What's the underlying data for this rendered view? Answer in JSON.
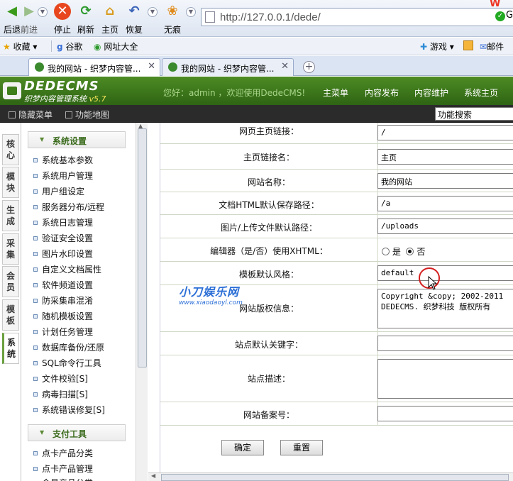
{
  "browser": {
    "nav": {
      "back": "后退",
      "forward": "前进",
      "stop": "停止",
      "refresh": "刷新",
      "home": "主页",
      "restore": "恢复",
      "incognito": "无痕"
    },
    "address": "http://127.0.0.1/dede/",
    "address_right_logo": "W",
    "go_label": "G"
  },
  "favorites": {
    "collect": "收藏",
    "google": "谷歌",
    "sites": "网址大全",
    "games": "游戏",
    "mail": "邮件"
  },
  "tabs": [
    {
      "label": "我的网站 - 织梦内容管..."
    },
    {
      "label": "我的网站 - 织梦内容管..."
    }
  ],
  "cms": {
    "logo_main": "DEDECMS",
    "logo_sub": "织梦内容管理系统",
    "version": "v5.7",
    "welcome": "您好：admin ，欢迎使用DedeCMS!",
    "topnav": [
      "主菜单",
      "内容发布",
      "内容维护",
      "系统主页"
    ],
    "hide_menu": "隐藏菜单",
    "func_map": "功能地图",
    "func_search": "功能搜索"
  },
  "vtabs": [
    {
      "label": "核心"
    },
    {
      "label": "模块"
    },
    {
      "label": "生成"
    },
    {
      "label": "采集"
    },
    {
      "label": "会员"
    },
    {
      "label": "模板"
    },
    {
      "label": "系统"
    }
  ],
  "menu": {
    "system_head": "系统设置",
    "system_items": [
      "系统基本参数",
      "系统用户管理",
      "用户组设定",
      "服务器分布/远程",
      "系统日志管理",
      "验证安全设置",
      "图片水印设置",
      "自定义文档属性",
      "软件频道设置",
      "防采集串混淆",
      "随机模板设置",
      "计划任务管理",
      "数据库备份/还原",
      "SQL命令行工具",
      "文件校验[S]",
      "病毒扫描[S]",
      "系统错误修复[S]"
    ],
    "pay_head": "支付工具",
    "pay_items": [
      "点卡产品分类",
      "点卡产品管理",
      "会员产品分类"
    ]
  },
  "form": {
    "rows": [
      {
        "label": "网页主页链接：",
        "value": "/"
      },
      {
        "label": "主页链接名：",
        "value": "主页"
      },
      {
        "label": "网站名称：",
        "value": "我的网站"
      },
      {
        "label": "文档HTML默认保存路径：",
        "value": "/a"
      },
      {
        "label": "图片/上传文件默认路径：",
        "value": "/uploads"
      },
      {
        "label": "编辑器（是/否）使用XHTML：",
        "yes": "是",
        "no": "否"
      },
      {
        "label": "模板默认风格：",
        "value": "default"
      },
      {
        "label": "网站版权信息：",
        "value": "Copyright &copy; 2002-2011 DEDECMS. 织梦科技 版权所有"
      },
      {
        "label": "站点默认关键字：",
        "value": ""
      },
      {
        "label": "站点描述：",
        "value": ""
      },
      {
        "label": "网站备案号：",
        "value": ""
      }
    ],
    "confirm": "确定",
    "reset": "重置"
  },
  "watermark": {
    "main": "小刀娱乐网",
    "sub": "www.xiaodaoyl.com"
  }
}
